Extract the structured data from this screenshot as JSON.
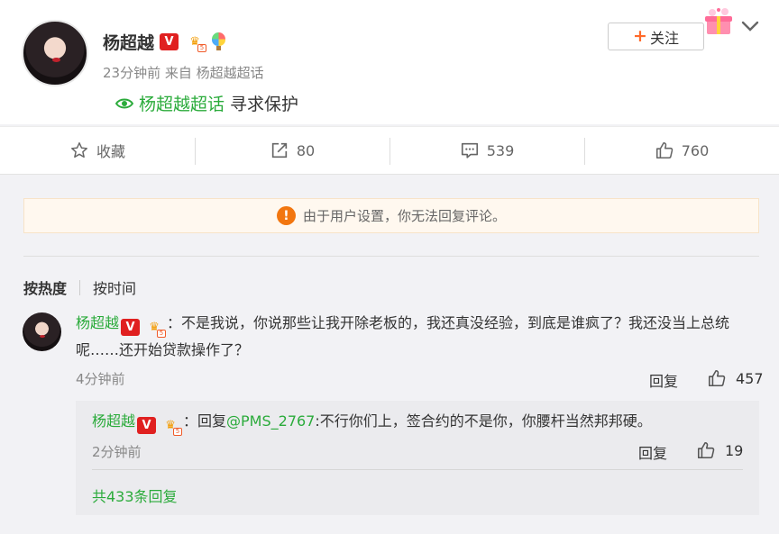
{
  "post": {
    "author": "杨超越",
    "verified_badge": "V",
    "time": "23分钟前",
    "source_prefix": "来自",
    "source": "杨超越超话",
    "topic": "杨超越超话",
    "topic_suffix": "寻求保护",
    "follow_label": "关注"
  },
  "actions": {
    "favorite_label": "收藏",
    "repost_count": "80",
    "comment_count": "539",
    "like_count": "760"
  },
  "notice": {
    "text": "由于用户设置，你无法回复评论。",
    "icon_char": "!"
  },
  "sort": {
    "by_heat": "按热度",
    "by_time": "按时间"
  },
  "comment": {
    "author": "杨超越",
    "text": "：不是我说，你说那些让我开除老板的，我还真没经验，到底是谁疯了？我还没当上总统呢……还开始贷款操作了？",
    "time": "4分钟前",
    "reply_label": "回复",
    "likes": "457"
  },
  "reply": {
    "author": "杨超越",
    "prefix": "：回复",
    "mention": "@PMS_2767",
    "text": ":不行你们上，签合约的不是你，你腰杆当然邦邦硬。",
    "time": "2分钟前",
    "reply_label": "回复",
    "likes": "19",
    "more": "共433条回复"
  },
  "colors": {
    "accent_green": "#2bab3b",
    "verified_red": "#e02020",
    "warning_orange": "#f2760f"
  }
}
